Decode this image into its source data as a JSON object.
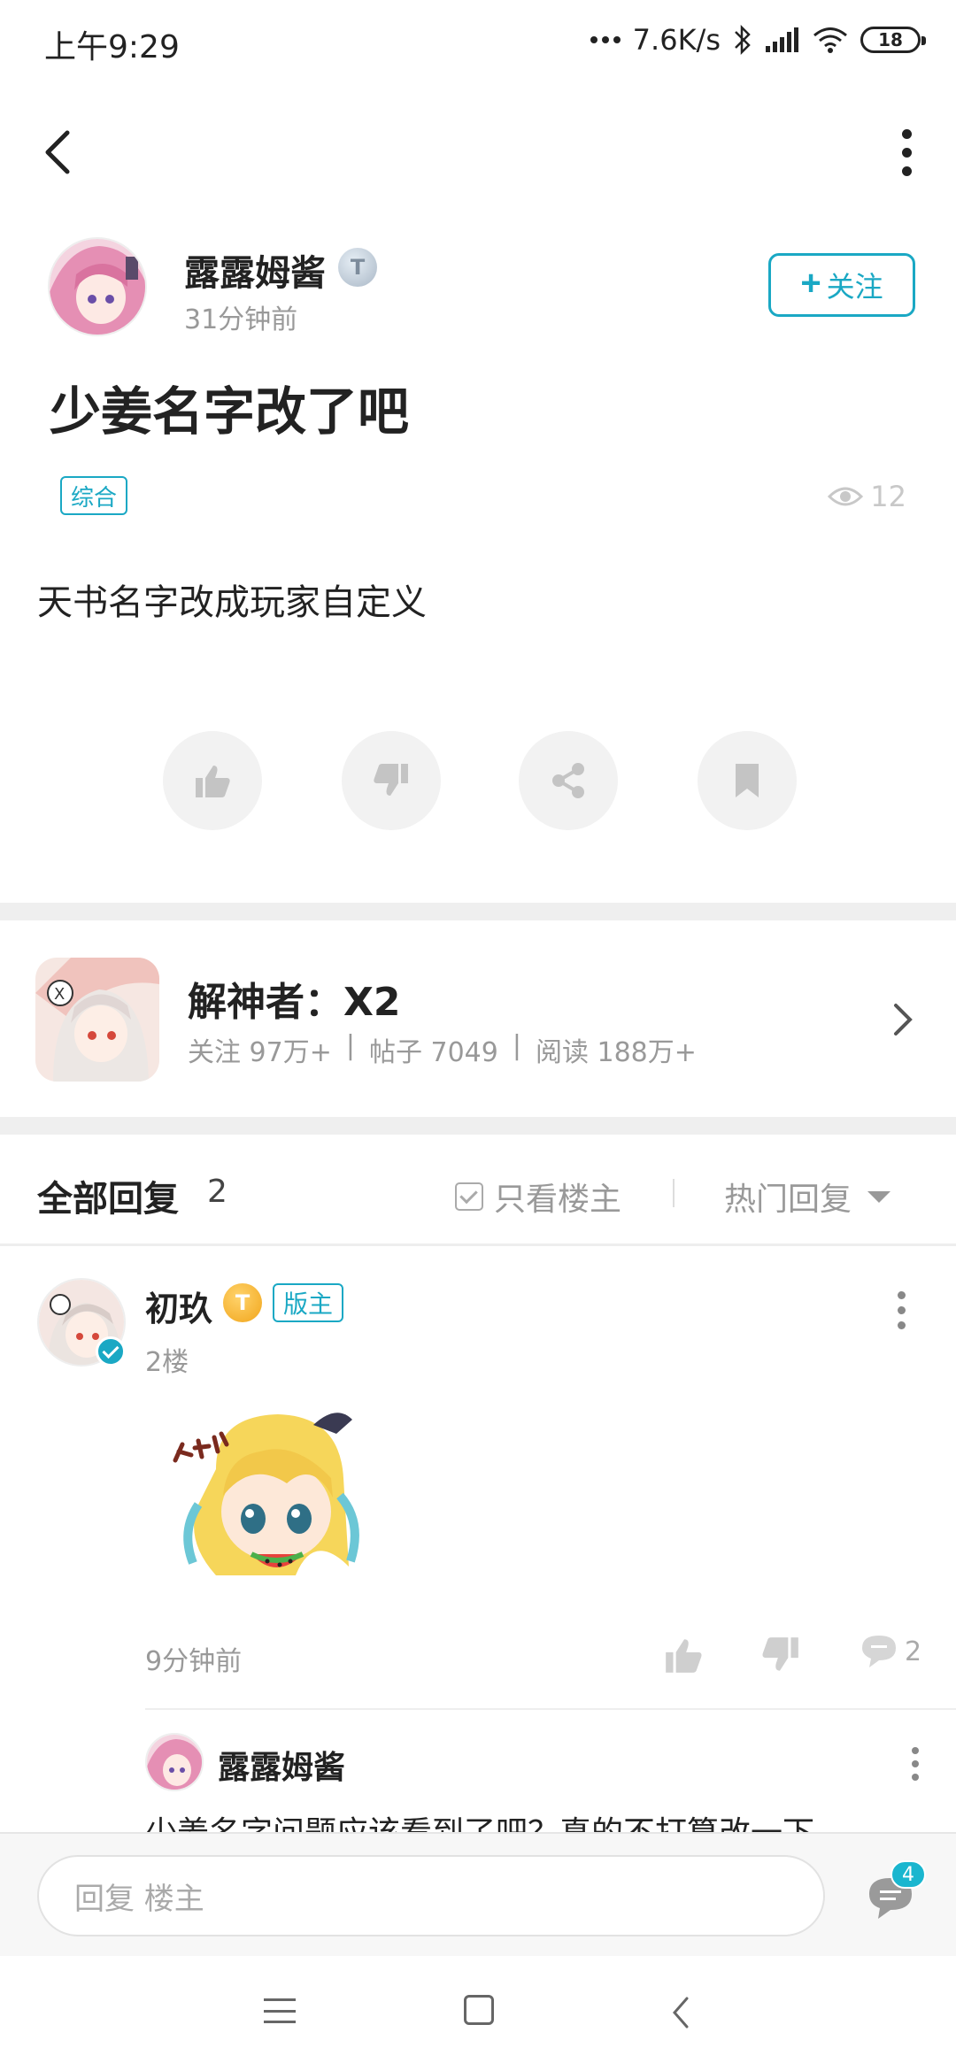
{
  "status_bar": {
    "time": "上午9:29",
    "net_speed": "7.6K/s",
    "battery": "18"
  },
  "post": {
    "author": {
      "name": "露露姆酱",
      "level_badge": "T",
      "time": "31分钟前",
      "follow_label": "关注",
      "follow_icon": "plus-icon"
    },
    "title": "少姜名字改了吧",
    "tag": "综合",
    "views": "12",
    "body": "天书名字改成玩家自定义",
    "actions": [
      "like-icon",
      "dislike-icon",
      "share-icon",
      "bookmark-icon"
    ]
  },
  "game": {
    "name": "解神者：X2",
    "stats": [
      "关注 97万+",
      "|",
      "帖子 7049",
      "|",
      "阅读 188万+"
    ]
  },
  "replies_header": {
    "title": "全部回复",
    "count": "2",
    "filter_label": "只看楼主",
    "sort_label": "热门回复"
  },
  "replies": [
    {
      "name": "初玖",
      "level_badge": "T",
      "role_tag": "版主",
      "floor": "2楼",
      "time": "9分钟前",
      "comment_count": "2",
      "sub_reply": {
        "name": "露露姆酱",
        "text": "少姜名字问题应该看到了吧？真的不打算改一下"
      }
    }
  ],
  "input_bar": {
    "placeholder": "回复  楼主",
    "message_badge": "4"
  },
  "colors": {
    "accent": "#1aa8c4",
    "gold_badge": "#f1a51b",
    "divider": "#efefef"
  }
}
